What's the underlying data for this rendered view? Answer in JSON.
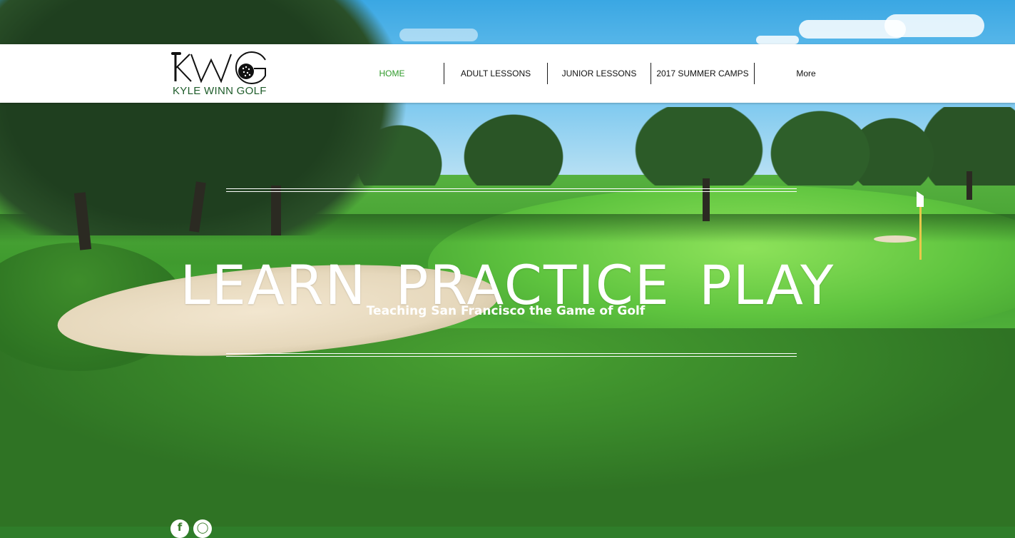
{
  "brand": {
    "logo_text": "KYLE WINN GOLF",
    "brand_color": "#1e5c2a"
  },
  "nav": {
    "items": [
      {
        "label": "HOME",
        "active": true
      },
      {
        "label": "ADULT LESSONS",
        "active": false
      },
      {
        "label": "JUNIOR LESSONS",
        "active": false
      },
      {
        "label": "2017 SUMMER CAMPS",
        "active": false
      },
      {
        "label": "More",
        "active": false
      }
    ],
    "active_color": "#2f9a2a"
  },
  "hero": {
    "title": "LEARN  PRACTICE  PLAY",
    "subtitle": "Teaching San Francisco the Game of Golf"
  },
  "social": {
    "icons": [
      "facebook-icon",
      "instagram-icon"
    ]
  }
}
